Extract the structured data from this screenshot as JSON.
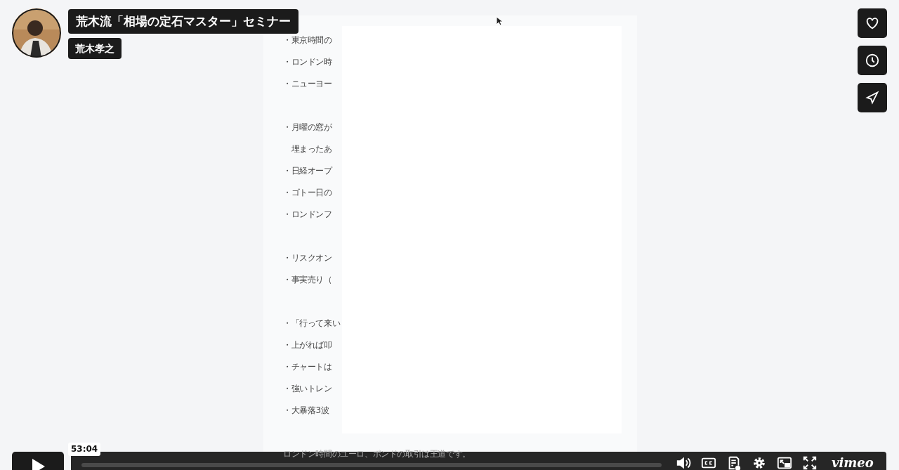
{
  "video": {
    "title": "荒木流「相場の定石マスター」セミナー",
    "author": "荒木孝之"
  },
  "document": {
    "paragraphs": [
      [
        "・東京時間の",
        "・ロンドン時",
        "・ニューヨー"
      ],
      [
        "・月曜の窓が",
        "　埋まったあ",
        "・日経オープ",
        "・ゴトー日の",
        "・ロンドンフ"
      ],
      [
        "・リスクオン",
        "・事実売り（"
      ],
      [
        "・「行って来い",
        "・上がれば叩",
        "・チャートは",
        "・強いトレン",
        "・大暴落3波"
      ],
      [
        "ロンドン時間のユーロ、ポンドの取引は王道です。"
      ]
    ]
  },
  "side_actions": [
    {
      "kind": "like"
    },
    {
      "kind": "watch_later"
    },
    {
      "kind": "share"
    }
  ],
  "player": {
    "time_tooltip": "53:04",
    "playing": false,
    "logo": "vimeo"
  }
}
